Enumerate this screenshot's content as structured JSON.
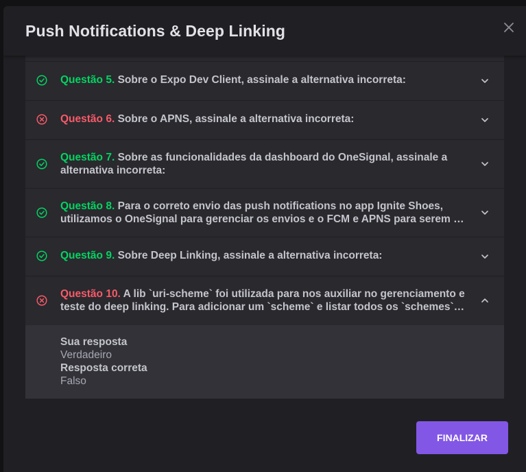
{
  "modal": {
    "title": "Push Notifications & Deep Linking",
    "close_icon": "close-icon"
  },
  "colors": {
    "correct": "#04d361",
    "wrong": "#f75a68",
    "accent": "#8257e5"
  },
  "questions": [
    {
      "number": "Questão 5.",
      "status": "correct",
      "lines": [
        "Sobre o Expo Dev Client, assinale a alternativa incorreta:"
      ],
      "expanded": false
    },
    {
      "number": "Questão 6.",
      "status": "wrong",
      "lines": [
        "Sobre o APNS, assinale a alternativa incorreta:"
      ],
      "expanded": false
    },
    {
      "number": "Questão 7.",
      "status": "correct",
      "lines": [
        "Sobre as funcionalidades da dashboard do OneSignal, assinale a",
        "alternativa incorreta:"
      ],
      "expanded": false
    },
    {
      "number": "Questão 8.",
      "status": "correct",
      "lines": [
        "Para o correto envio das push notifications no app Ignite Shoes,",
        "utilizamos o OneSignal para gerenciar os envios e o FCM e APNS para serem os enviados"
      ],
      "expanded": false
    },
    {
      "number": "Questão 9.",
      "status": "correct",
      "lines": [
        "Sobre Deep Linking, assinale a alternativa incorreta:"
      ],
      "expanded": false
    },
    {
      "number": "Questão 10.",
      "status": "wrong",
      "lines": [
        "A lib `uri-scheme` foi utilizada para nos auxiliar no gerenciamento e",
        "teste do deep linking. Para adicionar um `scheme` e listar todos os `schemes` do projeto"
      ],
      "expanded": true
    }
  ],
  "answer": {
    "your_label": "Sua resposta",
    "your_value": "Verdadeiro",
    "correct_label": "Resposta correta",
    "correct_value": "Falso"
  },
  "footer": {
    "finish_label": "FINALIZAR"
  }
}
